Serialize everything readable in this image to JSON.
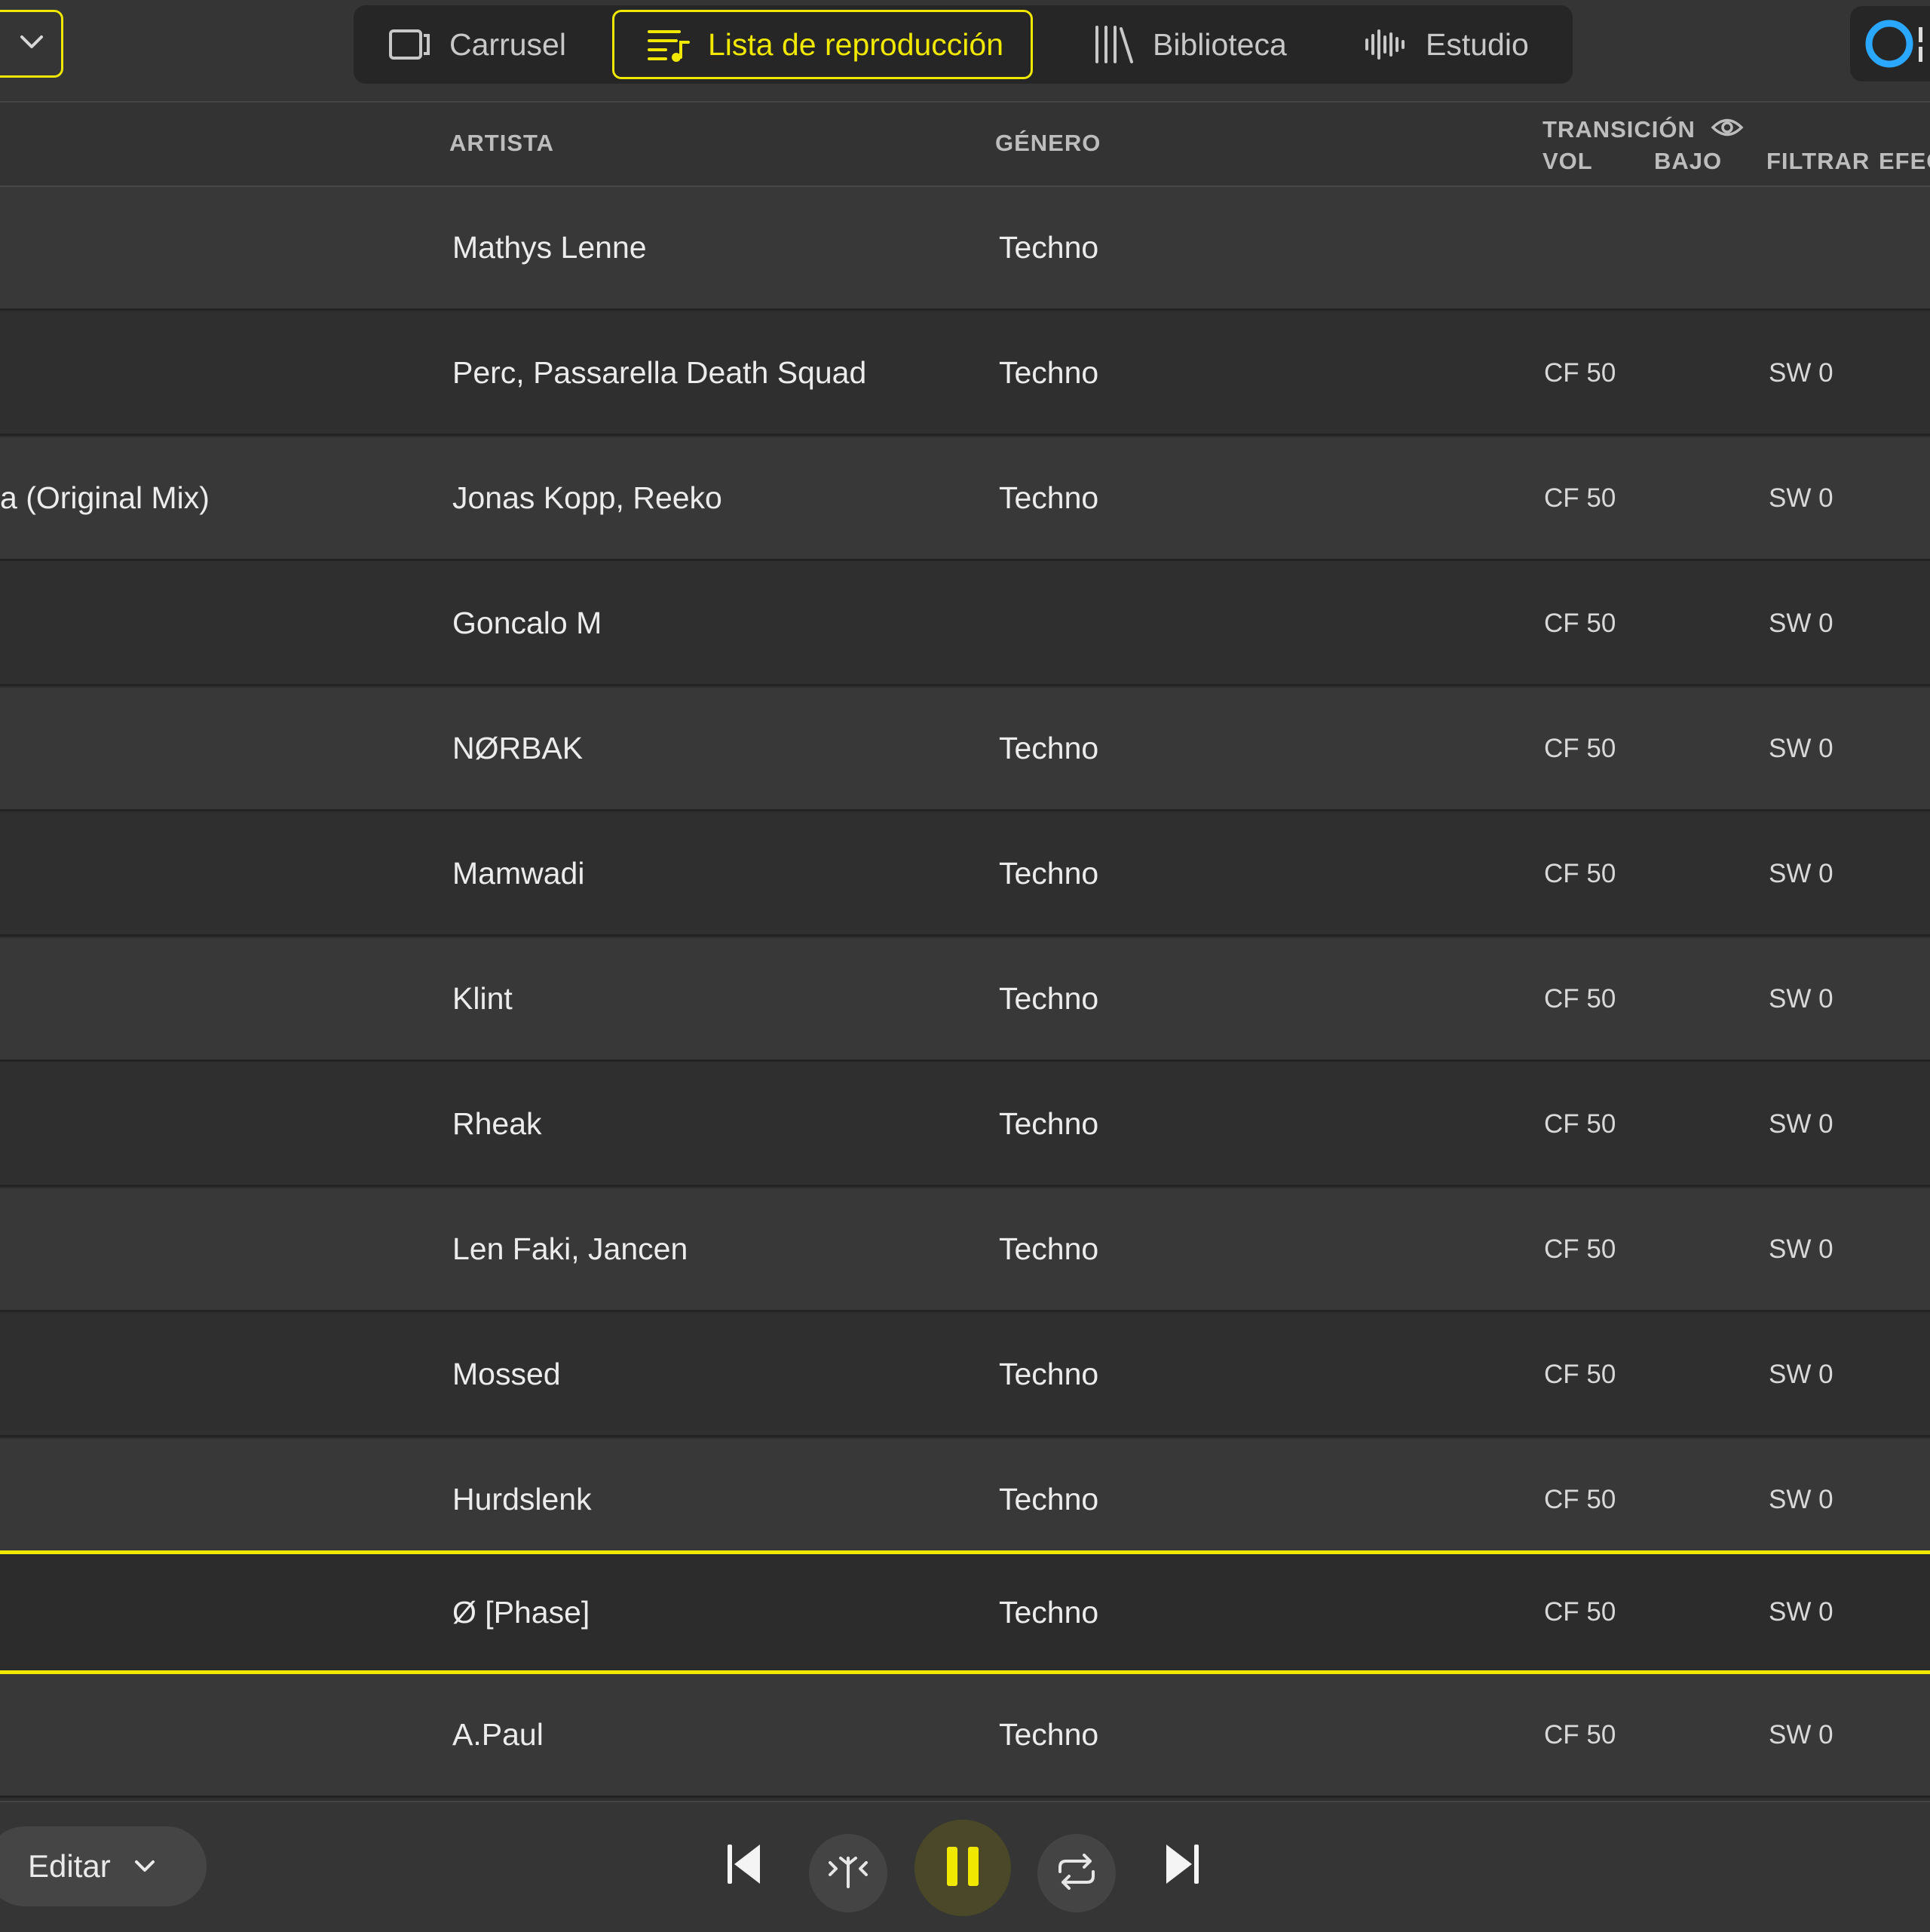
{
  "topbar": {
    "tabs": [
      {
        "label": "Carrusel",
        "icon": "carousel-icon"
      },
      {
        "label": "Lista de reproducción",
        "icon": "playlist-icon",
        "active": true
      },
      {
        "label": "Biblioteca",
        "icon": "library-icon"
      },
      {
        "label": "Estudio",
        "icon": "waveform-icon"
      }
    ]
  },
  "table": {
    "headers": {
      "artist": "ARTISTA",
      "genre": "GÉNERO",
      "transition": "TRANSICIÓN",
      "vol": "VOL",
      "bass": "BAJO",
      "filter": "FILTRAR",
      "effect": "EFEC"
    },
    "rows": [
      {
        "title": "",
        "artist": "Mathys Lenne",
        "genre": "Techno",
        "vol": "",
        "filter": ""
      },
      {
        "title": "",
        "artist": "Perc, Passarella Death Squad",
        "genre": "Techno",
        "vol": "CF 50",
        "filter": "SW 0"
      },
      {
        "title": "a (Original Mix)",
        "artist": "Jonas Kopp, Reeko",
        "genre": "Techno",
        "vol": "CF 50",
        "filter": "SW 0"
      },
      {
        "title": "",
        "artist": "Goncalo M",
        "genre": "",
        "vol": "CF 50",
        "filter": "SW 0"
      },
      {
        "title": "",
        "artist": "NØRBAK",
        "genre": "Techno",
        "vol": "CF 50",
        "filter": "SW 0"
      },
      {
        "title": "",
        "artist": "Mamwadi",
        "genre": "Techno",
        "vol": "CF 50",
        "filter": "SW 0"
      },
      {
        "title": "",
        "artist": "Klint",
        "genre": "Techno",
        "vol": "CF 50",
        "filter": "SW 0"
      },
      {
        "title": "",
        "artist": "Rheak",
        "genre": "Techno",
        "vol": "CF 50",
        "filter": "SW 0"
      },
      {
        "title": "",
        "artist": "Len Faki, Jancen",
        "genre": "Techno",
        "vol": "CF 50",
        "filter": "SW 0"
      },
      {
        "title": "",
        "artist": "Mossed",
        "genre": "Techno",
        "vol": "CF 50",
        "filter": "SW 0"
      },
      {
        "title": "",
        "artist": "Hurdslenk",
        "genre": "Techno",
        "vol": "CF 50",
        "filter": "SW 0"
      },
      {
        "title": "",
        "artist": "Ø [Phase]",
        "genre": "Techno",
        "vol": "CF 50",
        "filter": "SW 0",
        "playing": true
      },
      {
        "title": "",
        "artist": "A.Paul",
        "genre": "Techno",
        "vol": "CF 50",
        "filter": "SW 0"
      }
    ]
  },
  "bottombar": {
    "edit_label": "Editar"
  },
  "colors": {
    "accent": "#f1e800",
    "logo": "#2aa8ff"
  }
}
